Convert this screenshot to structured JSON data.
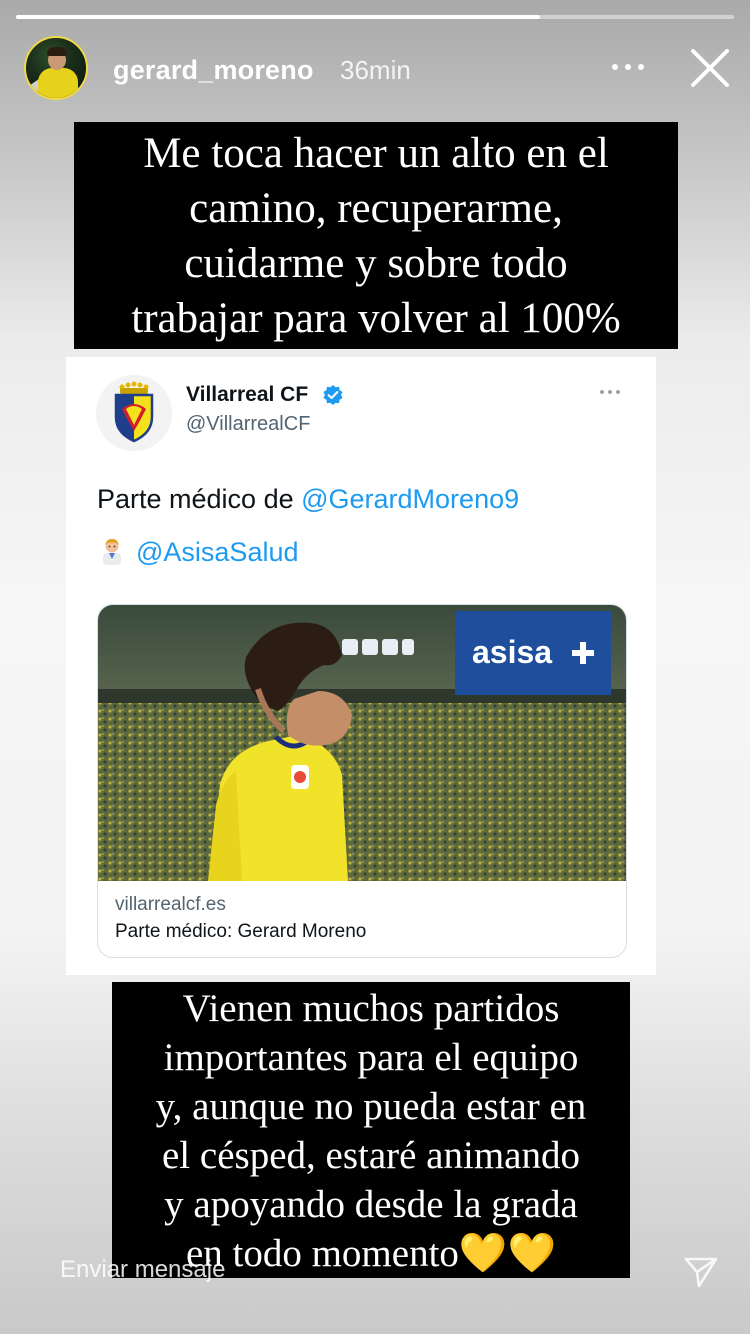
{
  "story": {
    "progress": 0.73,
    "username": "gerard_moreno",
    "time": "36min",
    "top_caption": [
      "Me toca hacer un alto en el",
      "camino, recuperarme,",
      "cuidarme y sobre todo",
      "trabajar para volver al 100%"
    ],
    "bottom_caption": [
      "Vienen muchos partidos",
      "importantes para el equipo",
      "y, aunque no pueda estar en",
      "el césped, estaré animando",
      "y apoyando desde la grada",
      "en todo momento"
    ],
    "bottom_caption_hearts": "💛💛",
    "message_placeholder": "Enviar mensaje"
  },
  "tweet": {
    "account_name": "Villarreal CF",
    "account_handle": "@VillarrealCF",
    "text_prefix": "Parte médico de ",
    "text_mention": "@GerardMoreno9",
    "line2_mention": "@AsisaSalud",
    "link_card": {
      "sponsor_logo": "asisa",
      "domain": "villarrealcf.es",
      "title": "Parte médico: Gerard Moreno"
    }
  },
  "colors": {
    "mention_blue": "#1d9bf0",
    "verified_blue": "#1d9bf0",
    "villarreal_yellow": "#f5e21c",
    "asisa_blue": "#1f4f9c",
    "caption_bg": "#000000"
  },
  "icons": [
    "more-icon",
    "close-icon",
    "verified-icon",
    "tweet-more-icon",
    "doctor-emoji-icon",
    "send-icon",
    "club-logo"
  ]
}
